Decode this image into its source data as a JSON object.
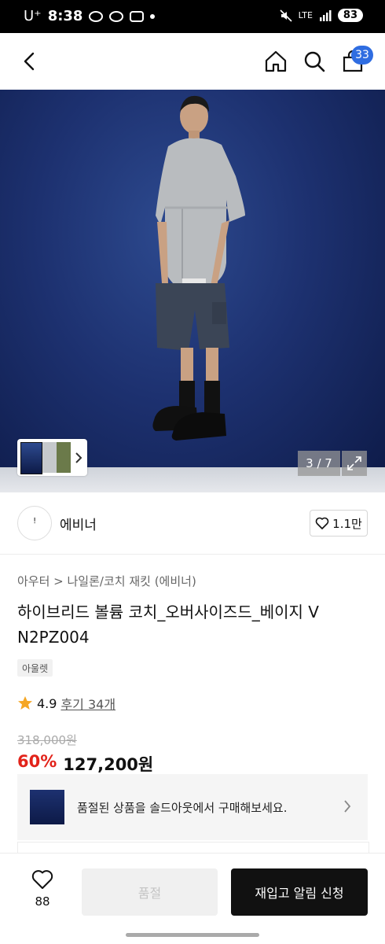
{
  "status_bar": {
    "carrier": "U⁺",
    "time": "8:38",
    "network": "LTE",
    "battery": "83"
  },
  "nav": {
    "cart_count": "33"
  },
  "gallery": {
    "counter": "3 / 7"
  },
  "brand": {
    "name": "에비너",
    "logo_glyph": "ꜝ",
    "likes": "1.1만"
  },
  "product": {
    "breadcrumb": "아우터 > 나일론/코치 재킷 (에비너)",
    "title": "하이브리드 볼륨 코치_오버사이즈드_베이지 V N2PZ004",
    "tag": "아울렛",
    "rating": "4.9",
    "review": "후기 34개",
    "original_price": "318,000원",
    "discount": "60%",
    "sale_price": "127,200원"
  },
  "banner": {
    "text": "품절된 상품을 솔드아웃에서 구매해보세요."
  },
  "bottom": {
    "wish_count": "88",
    "soldout_label": "품절",
    "restock_label": "재입고 알림 신청"
  },
  "colors": {
    "accent_blue": "#2f6de1",
    "discount_red": "#e2231a",
    "star": "#f5a623"
  }
}
